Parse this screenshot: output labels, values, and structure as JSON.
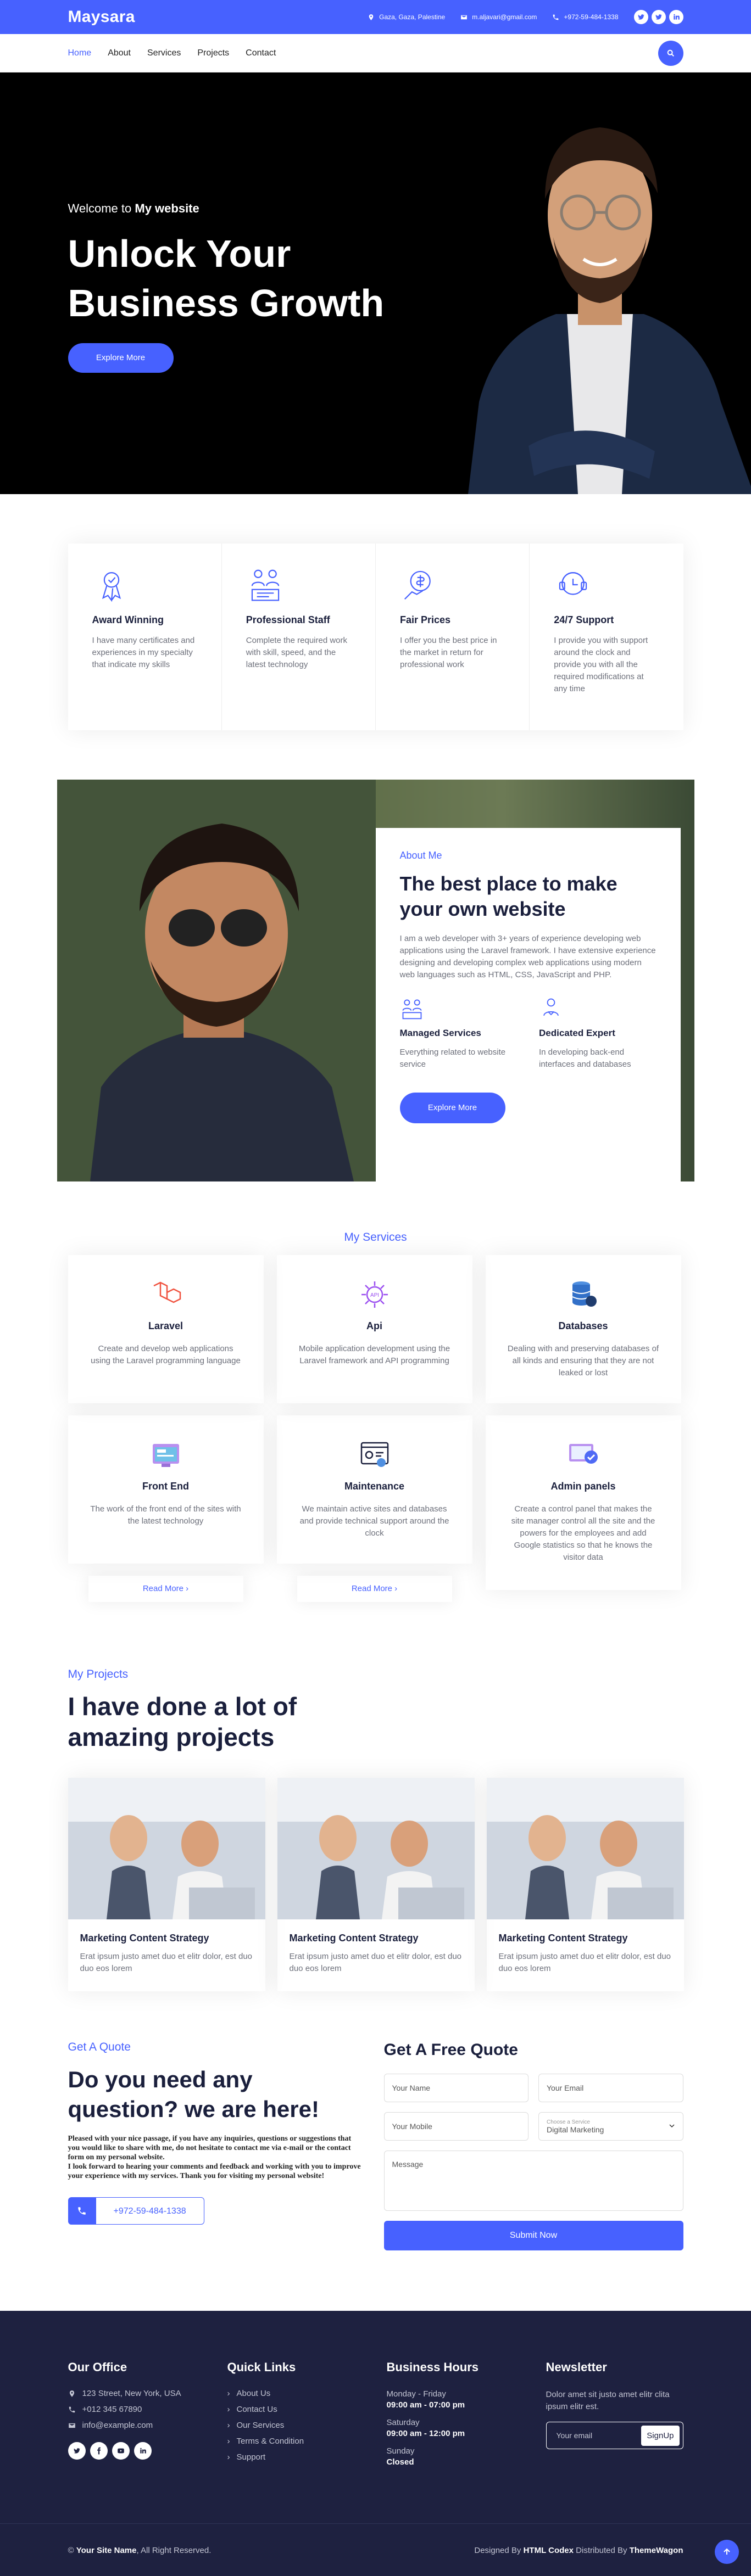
{
  "topbar": {
    "brand": "Maysara",
    "address": "Gaza, Gaza, Palestine",
    "email": "m.aljavari@gmail.com",
    "phone": "+972-59-484-1338"
  },
  "nav": {
    "items": [
      "Home",
      "About",
      "Services",
      "Projects",
      "Contact"
    ]
  },
  "hero": {
    "subtitle_prefix": "Welcome to",
    "subtitle_bold": "My website",
    "title_line1": "Unlock Your",
    "title_line2": "Business Growth",
    "button": "Explore More"
  },
  "features": [
    {
      "icon": "award-icon",
      "title": "Award Winning",
      "text": "I have many certificates and experiences in my specialty that indicate my skills"
    },
    {
      "icon": "staff-icon",
      "title": "Professional Staff",
      "text": "Complete the required work with skill, speed, and the latest technology"
    },
    {
      "icon": "price-icon",
      "title": "Fair Prices",
      "text": "I offer you the best price in the market in return for professional work"
    },
    {
      "icon": "support-icon",
      "title": "24/7 Support",
      "text": "I provide you with support around the clock and provide you with all the required modifications at any time"
    }
  ],
  "about": {
    "label": "About Me",
    "title": "The best place to make your own website",
    "text": "I am a web developer with 3+ years of experience developing web applications using the Laravel framework. I have extensive experience designing and developing complex web applications using modern web languages such as HTML, CSS, JavaScript and PHP.",
    "services": [
      {
        "title": "Managed Services",
        "text": "Everything related to website service"
      },
      {
        "title": "Dedicated Expert",
        "text": "In developing back-end interfaces and databases"
      }
    ],
    "button": "Explore More"
  },
  "services": {
    "label": "My Services",
    "items": [
      {
        "icon": "laravel-icon",
        "title": "Laravel",
        "text": "Create and develop web applications using the Laravel programming language"
      },
      {
        "icon": "api-icon",
        "title": "Api",
        "text": "Mobile application development using the Laravel framework and API programming"
      },
      {
        "icon": "database-icon",
        "title": "Databases",
        "text": "Dealing with and preserving databases of all kinds and ensuring that they are not leaked or lost"
      },
      {
        "icon": "frontend-icon",
        "title": "Front End",
        "text": "The work of the front end of the sites with the latest technology"
      },
      {
        "icon": "maintenance-icon",
        "title": "Maintenance",
        "text": "We maintain active sites and databases and provide technical support around the clock"
      },
      {
        "icon": "admin-panel-icon",
        "title": "Admin panels",
        "text": "Create a control panel that makes the site manager control all the site and the powers for the employees and add Google statistics so that he knows the visitor data"
      }
    ],
    "read_more": "Read More"
  },
  "projects": {
    "label": "My Projects",
    "title_line1": "I have done a lot of",
    "title_line2": "amazing projects",
    "items": [
      {
        "title": "Marketing Content Strategy",
        "text": "Erat ipsum justo amet duo et elitr dolor, est duo duo eos lorem"
      },
      {
        "title": "Marketing Content Strategy",
        "text": "Erat ipsum justo amet duo et elitr dolor, est duo duo eos lorem"
      },
      {
        "title": "Marketing Content Strategy",
        "text": "Erat ipsum justo amet duo et elitr dolor, est duo duo eos lorem"
      }
    ]
  },
  "quote": {
    "label": "Get A Quote",
    "title": "Do you need any question? we are here!",
    "text1": "Pleased with your nice passage, if you have any inquiries, questions or suggestions that you would like to share with me, do not hesitate to contact me via e-mail or the contact form on my personal website.",
    "text2": "I look forward to hearing your comments and feedback and working with you to improve your experience with my services. Thank you for visiting my personal website!",
    "phone": "+972-59-484-1338",
    "form_title": "Get A Free Quote",
    "name_placeholder": "Your Name",
    "email_placeholder": "Your Email",
    "mobile_placeholder": "Your Mobile",
    "service_label": "Choose a Service",
    "service_value": "Digital Marketing",
    "message_placeholder": "Message",
    "submit": "Submit Now"
  },
  "footer": {
    "office_title": "Our Office",
    "address": "123 Street, New York, USA",
    "phone": "+012 345 67890",
    "email": "info@example.com",
    "links_title": "Quick Links",
    "links": [
      "About Us",
      "Contact Us",
      "Our Services",
      "Terms & Condition",
      "Support"
    ],
    "hours_title": "Business Hours",
    "h1_label": "Monday - Friday",
    "h1_value": "09:00 am - 07:00 pm",
    "h2_label": "Saturday",
    "h2_value": "09:00 am - 12:00 pm",
    "h3_label": "Sunday",
    "h3_value": "Closed",
    "news_title": "Newsletter",
    "news_text": "Dolor amet sit justo amet elitr clita ipsum elitr est.",
    "news_placeholder": "Your email",
    "news_button": "SignUp",
    "copy_prefix": "©",
    "copy_site": "Your Site Name",
    "copy_suffix": ", All Right Reserved.",
    "designed_prefix": "Designed By",
    "designed_by": "HTML Codex",
    "distributed_prefix": "Distributed By",
    "distributed_by": "ThemeWagon"
  }
}
